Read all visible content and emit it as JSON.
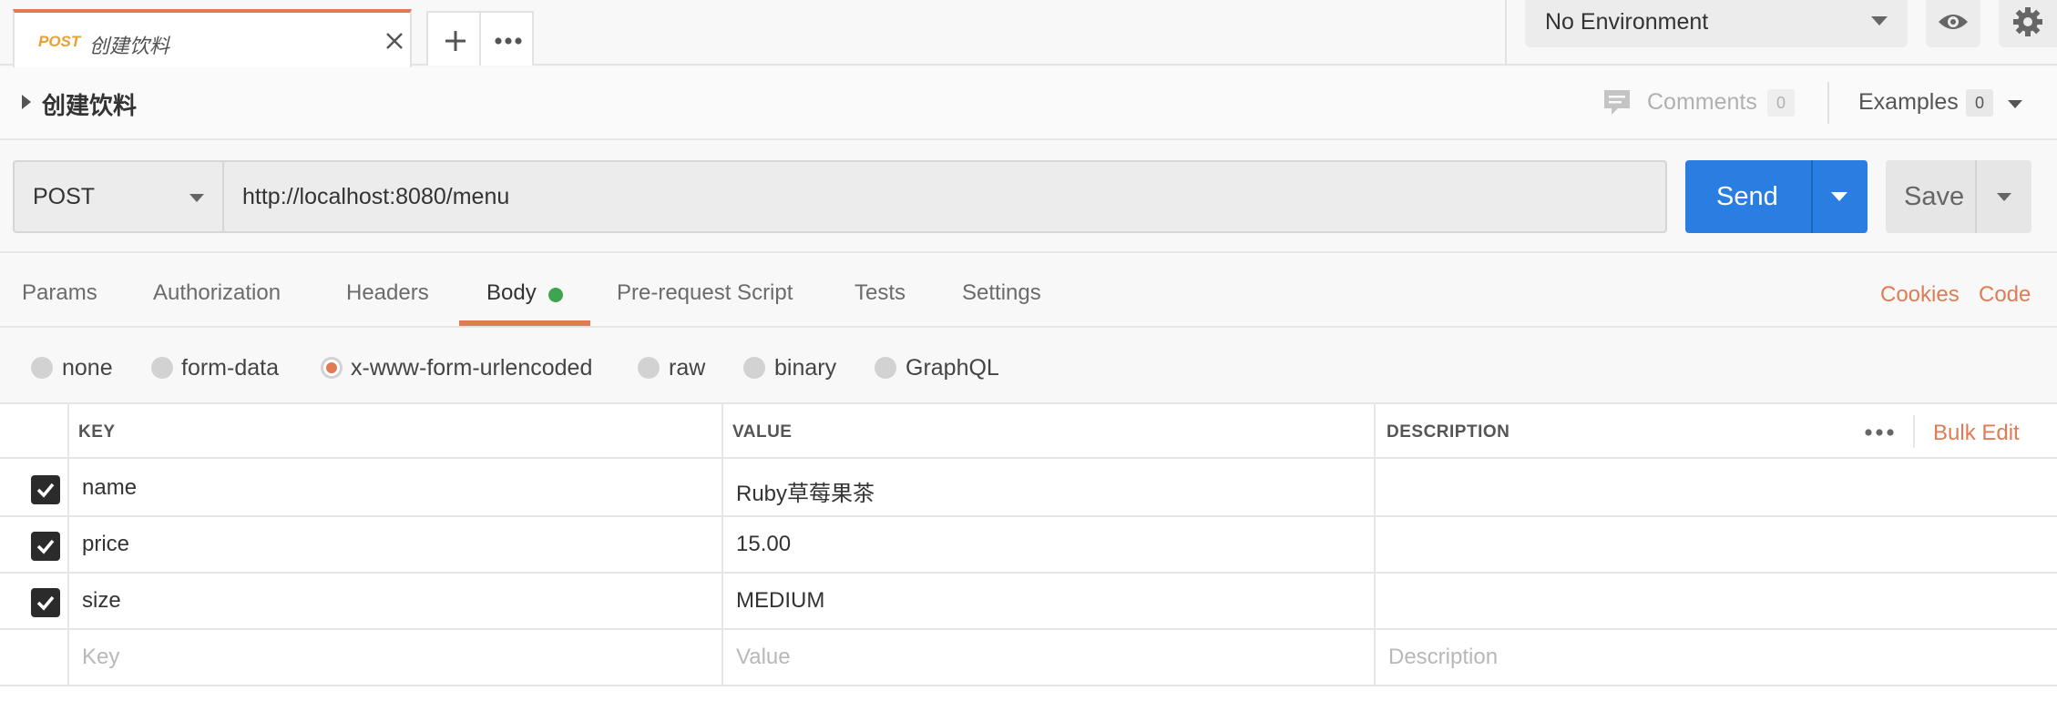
{
  "tab": {
    "method": "POST",
    "name": "创建饮料"
  },
  "environment": {
    "selected": "No Environment"
  },
  "request": {
    "title": "创建饮料",
    "comments_label": "Comments",
    "comments_count": "0",
    "examples_label": "Examples",
    "examples_count": "0",
    "method": "POST",
    "url": "http://localhost:8080/menu",
    "send_label": "Send",
    "save_label": "Save"
  },
  "request_tabs": [
    {
      "label": "Params"
    },
    {
      "label": "Authorization"
    },
    {
      "label": "Headers"
    },
    {
      "label": "Body",
      "active": true
    },
    {
      "label": "Pre-request Script"
    },
    {
      "label": "Tests"
    },
    {
      "label": "Settings"
    }
  ],
  "links": {
    "cookies": "Cookies",
    "code": "Code"
  },
  "body_types": [
    {
      "label": "none"
    },
    {
      "label": "form-data"
    },
    {
      "label": "x-www-form-urlencoded",
      "selected": true
    },
    {
      "label": "raw"
    },
    {
      "label": "binary"
    },
    {
      "label": "GraphQL"
    }
  ],
  "table": {
    "headers": {
      "key": "KEY",
      "value": "VALUE",
      "description": "DESCRIPTION"
    },
    "bulk_edit": "Bulk Edit",
    "rows": [
      {
        "checked": true,
        "key": "name",
        "value": "Ruby草莓果茶",
        "description": ""
      },
      {
        "checked": true,
        "key": "price",
        "value": "15.00",
        "description": ""
      },
      {
        "checked": true,
        "key": "size",
        "value": "MEDIUM",
        "description": ""
      }
    ],
    "placeholders": {
      "key": "Key",
      "value": "Value",
      "description": "Description"
    }
  },
  "colors": {
    "accent": "#e07b53",
    "send": "#2a7de1",
    "method_tab": "#e8a030",
    "body_dot": "#3ea44f"
  },
  "icons": [
    "close-icon",
    "plus-icon",
    "more-icon",
    "caret-down-icon",
    "eye-icon",
    "gear-icon",
    "comment-icon",
    "checkbox-checked-icon"
  ]
}
